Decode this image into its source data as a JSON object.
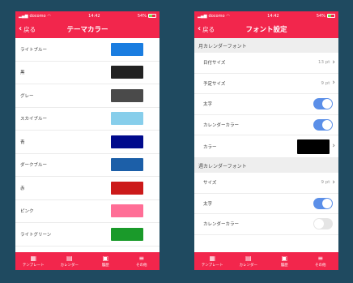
{
  "status": {
    "carrier": "docomo",
    "time": "14:42",
    "battery": "54%"
  },
  "left": {
    "back": "戻る",
    "title": "テーマカラー",
    "colors": [
      {
        "name": "ライトブルー",
        "hex": "#1a7de0"
      },
      {
        "name": "黒",
        "hex": "#222222"
      },
      {
        "name": "グレー",
        "hex": "#4a4a4a"
      },
      {
        "name": "スカイブルー",
        "hex": "#87ceeb"
      },
      {
        "name": "青",
        "hex": "#000a8c"
      },
      {
        "name": "ダークブルー",
        "hex": "#1c5fa8"
      },
      {
        "name": "赤",
        "hex": "#cc1a1a"
      },
      {
        "name": "ピンク",
        "hex": "#ff6e96"
      },
      {
        "name": "ライトグリーン",
        "hex": "#1a9a2a"
      }
    ]
  },
  "right": {
    "back": "戻る",
    "title": "フォント設定",
    "section1": "月カレンダーフォント",
    "date_size_label": "日付サイズ",
    "date_size_value": "13 pt",
    "event_size_label": "予定サイズ",
    "event_size_value": "9 pt",
    "bold_label": "太字",
    "calendar_color_label": "カレンダーカラー",
    "color_label": "カラー",
    "section2": "週カレンダーフォント",
    "w_size_label": "サイズ",
    "w_size_value": "9 pt",
    "w_bold_label": "太字",
    "w_calendar_color_label": "カレンダーカラー"
  },
  "tabs": [
    {
      "label": "テンプレート",
      "icon": "template-icon"
    },
    {
      "label": "カレンダー",
      "icon": "calendar-icon"
    },
    {
      "label": "履歴",
      "icon": "history-icon"
    },
    {
      "label": "その他",
      "icon": "menu-icon"
    }
  ],
  "accent": "#f2264c",
  "toggle_on": "#5b8fe8"
}
